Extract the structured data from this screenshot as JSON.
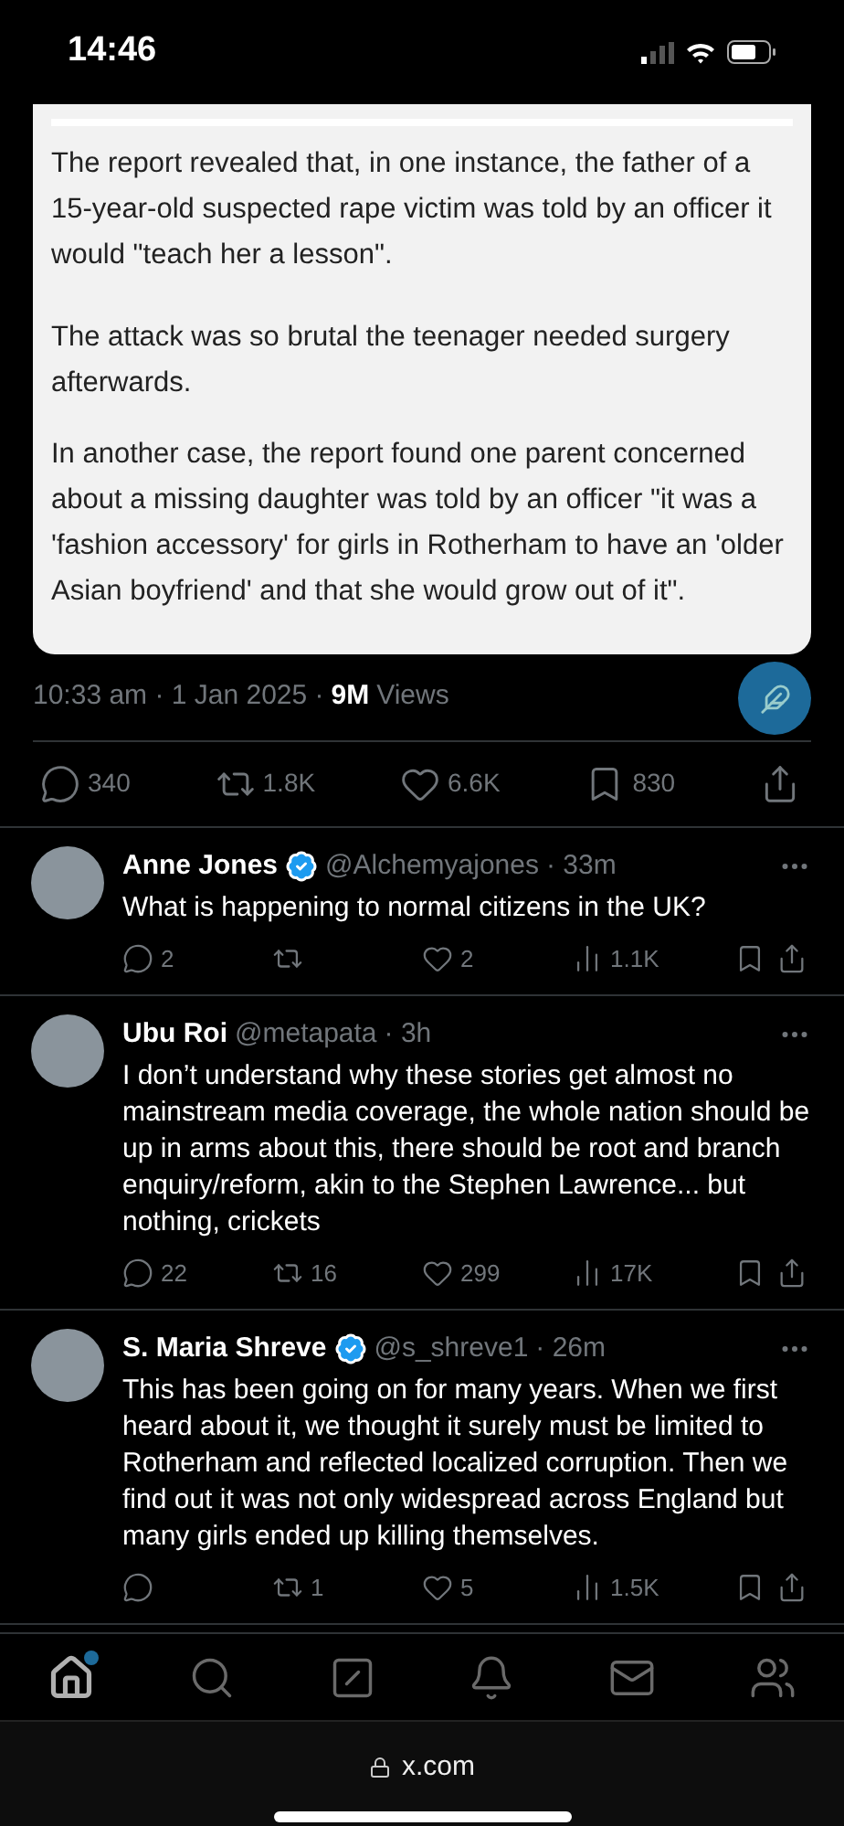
{
  "status_bar": {
    "time": "14:46"
  },
  "article": {
    "paragraphs": [
      "The report revealed that, in one instance, the father of a 15-year-old suspected rape victim was told by an officer it would \"teach her a lesson\".",
      "The attack was so brutal the teenager needed surgery afterwards.",
      "In another case, the report found one parent concerned about a missing daughter was told by an officer \"it was a 'fashion accessory' for girls in Rotherham to have an 'older Asian boyfriend' and that she would grow out of it\"."
    ]
  },
  "post_meta": {
    "timestamp": "10:33 am · 1 Jan 2025 ·",
    "views": "9M",
    "views_label": "Views"
  },
  "stats": [
    {
      "kind": "reply",
      "count": "340"
    },
    {
      "kind": "repost",
      "count": "1.8K"
    },
    {
      "kind": "like",
      "count": "6.6K"
    },
    {
      "kind": "bookmark",
      "count": "830"
    },
    {
      "kind": "share"
    }
  ],
  "replies": [
    {
      "name": "Anne Jones",
      "verified": true,
      "handle": "@Alchemyajones",
      "time": "· 33m",
      "text": "What is happening to normal citizens in the UK?",
      "actions": [
        {
          "kind": "reply",
          "count": "2"
        },
        {
          "kind": "repost"
        },
        {
          "kind": "like",
          "count": "2"
        },
        {
          "kind": "views",
          "count": "1.1K"
        },
        {
          "kind": "bookmark"
        },
        {
          "kind": "share"
        }
      ]
    },
    {
      "name": "Ubu Roi",
      "verified": false,
      "handle": "@metapata",
      "time": "· 3h",
      "text": "I don’t understand why these stories get almost no mainstream media coverage, the whole nation should be up in arms about this, there should be root and branch enquiry/reform, akin to the Stephen Lawrence... but nothing, crickets",
      "actions": [
        {
          "kind": "reply",
          "count": "22"
        },
        {
          "kind": "repost",
          "count": "16"
        },
        {
          "kind": "like",
          "count": "299"
        },
        {
          "kind": "views",
          "count": "17K"
        },
        {
          "kind": "bookmark"
        },
        {
          "kind": "share"
        }
      ]
    },
    {
      "name": "S. Maria Shreve",
      "verified": true,
      "handle": "@s_shreve1",
      "time": "· 26m",
      "text": "This has been going on for many years. When we first heard about it, we thought it surely must be limited to Rotherham and reflected localized corruption. Then we find out it was not only widespread across England but many girls ended up killing themselves.",
      "actions": [
        {
          "kind": "reply"
        },
        {
          "kind": "repost",
          "count": "1"
        },
        {
          "kind": "like",
          "count": "5"
        },
        {
          "kind": "views",
          "count": "1.5K"
        },
        {
          "kind": "bookmark"
        },
        {
          "kind": "share"
        }
      ]
    }
  ],
  "bottom_nav": [
    {
      "kind": "home",
      "selected": true,
      "notification": true
    },
    {
      "kind": "search",
      "selected": false,
      "notification": false
    },
    {
      "kind": "grok",
      "selected": false,
      "notification": false
    },
    {
      "kind": "notifications",
      "selected": false,
      "notification": false
    },
    {
      "kind": "messages",
      "selected": false,
      "notification": false
    },
    {
      "kind": "communities",
      "selected": false,
      "notification": false
    }
  ],
  "browser_bar": {
    "url": "x.com"
  }
}
